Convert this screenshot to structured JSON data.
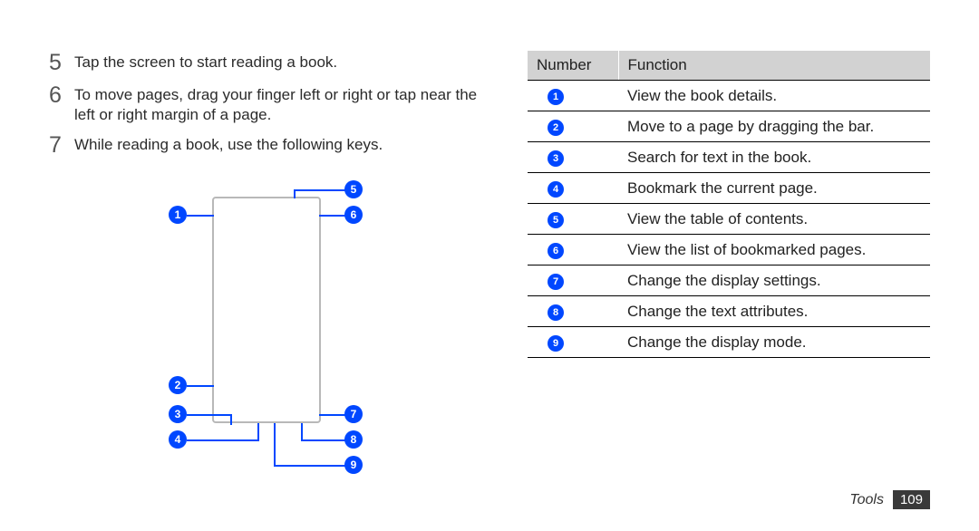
{
  "steps": [
    {
      "n": "5",
      "text": "Tap the screen to start reading a book."
    },
    {
      "n": "6",
      "text": "To move pages, drag your ﬁnger left or right or tap near the left or right margin of a page."
    },
    {
      "n": "7",
      "text": "While reading a book, use the following keys."
    }
  ],
  "callouts": [
    "1",
    "2",
    "3",
    "4",
    "5",
    "6",
    "7",
    "8",
    "9"
  ],
  "table": {
    "head": {
      "c1": "Number",
      "c2": "Function"
    },
    "rows": [
      {
        "n": "1",
        "f": "View the book details."
      },
      {
        "n": "2",
        "f": "Move to a page by dragging the bar."
      },
      {
        "n": "3",
        "f": "Search for text in the book."
      },
      {
        "n": "4",
        "f": "Bookmark the current page."
      },
      {
        "n": "5",
        "f": "View the table of contents."
      },
      {
        "n": "6",
        "f": "View the list of bookmarked pages."
      },
      {
        "n": "7",
        "f": "Change the display settings."
      },
      {
        "n": "8",
        "f": "Change the text attributes."
      },
      {
        "n": "9",
        "f": "Change the display mode."
      }
    ]
  },
  "footer": {
    "section": "Tools",
    "page": "109"
  }
}
